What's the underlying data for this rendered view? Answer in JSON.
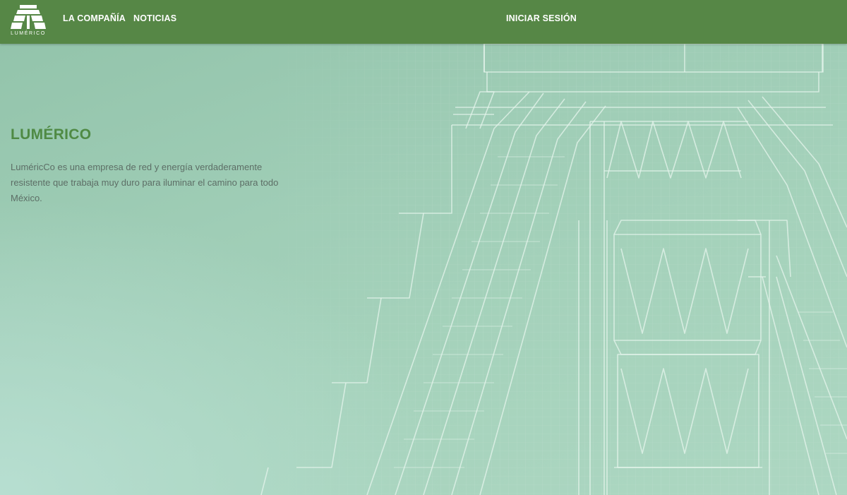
{
  "header": {
    "logo_text": "LUMÉRICO",
    "nav": {
      "company": "LA COMPAÑÍA",
      "news": "NOTICIAS",
      "login": "INICIAR SESIÓN"
    }
  },
  "hero": {
    "title": "LUMÉRICO",
    "description": "LuméricCo es una empresa de red y energía verdaderamente resistente que trabaja muy duro para iluminar el camino para todo México."
  },
  "colors": {
    "header_bg": "#568746",
    "title_green": "#4f8a44",
    "body_text": "#5d6e66",
    "hero_bg": "#a5d2bb"
  },
  "icons": {
    "logo": "pyramid-logo-icon"
  }
}
